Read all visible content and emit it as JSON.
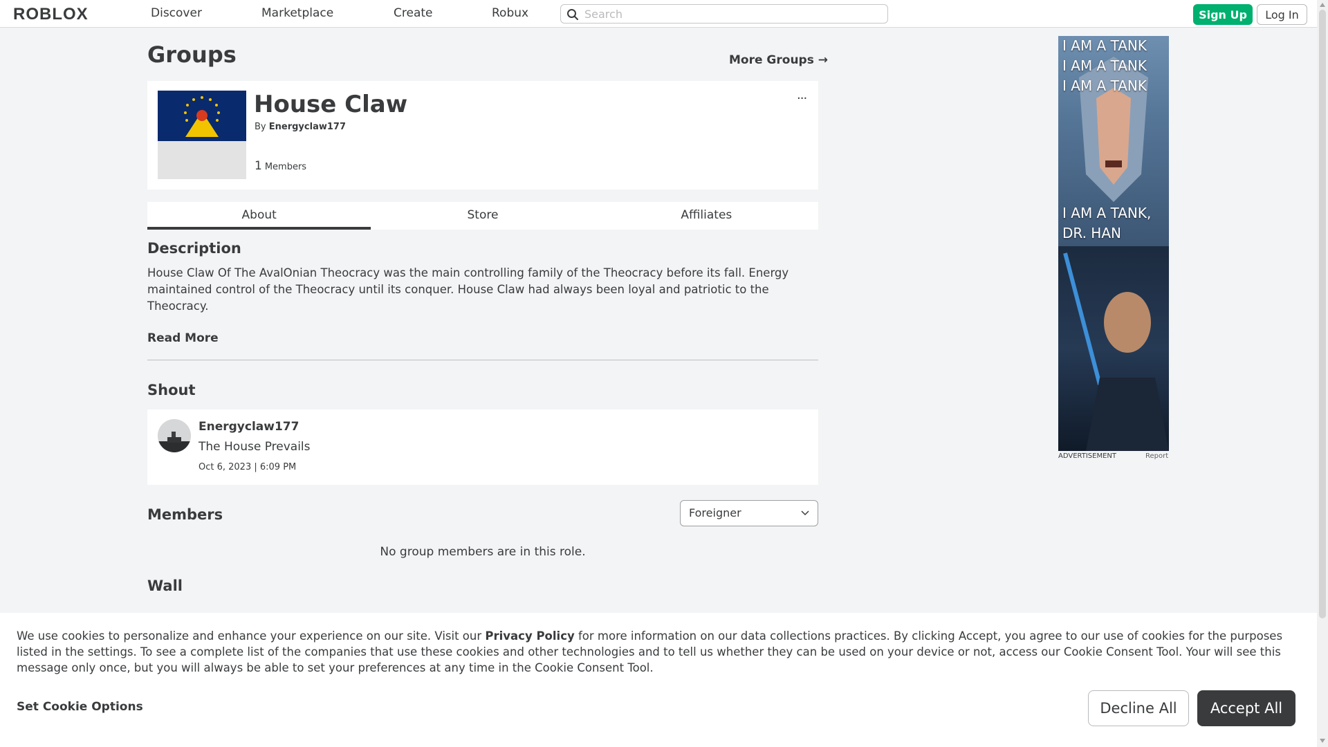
{
  "nav": {
    "logo": "ROBLOX",
    "links": [
      "Discover",
      "Marketplace",
      "Create",
      "Robux"
    ],
    "search_placeholder": "Search",
    "signup_label": "Sign Up",
    "login_label": "Log In"
  },
  "page": {
    "title": "Groups",
    "more_groups": "More Groups →"
  },
  "group": {
    "name": "House Claw",
    "by_prefix": "By",
    "owner": "Energyclaw177",
    "member_count": "1",
    "members_label": "Members",
    "more_icon": "..."
  },
  "tabs": [
    "About",
    "Store",
    "Affiliates"
  ],
  "about": {
    "description_heading": "Description",
    "description": "House Claw Of The AvalOnian Theocracy was the main controlling family of the Theocracy before its fall. Energy maintained control of the Theocracy until its conquer. House Claw had always been loyal and patriotic to the Theocracy.",
    "read_more": "Read More",
    "shout_heading": "Shout",
    "shout": {
      "user": "Energyclaw177",
      "text": "The House Prevails",
      "date": "Oct 6, 2023 | 6:09 PM"
    },
    "members_heading": "Members",
    "role_selected": "Foreigner",
    "no_members": "No group members are in this role.",
    "wall_heading": "Wall"
  },
  "ad": {
    "lines_top": [
      "I AM A TANK",
      "I AM A TANK",
      "I AM A TANK"
    ],
    "lines_mid": [
      "I AM A TANK,",
      "DR. HAN"
    ],
    "label": "ADVERTISEMENT",
    "report": "Report"
  },
  "cookie": {
    "text_before": "We use cookies to personalize and enhance your experience on our site. Visit our",
    "policy_link": "Privacy Policy",
    "text_after": "for more information on our data collections practices. By clicking Accept, you agree to our use of cookies for the purposes listed in the settings. To see a complete list of the companies that use these cookies and other technologies and to tell us whether they can be used on your device or not, access our Cookie Consent Tool. Your will see this message only once, but you will always be able to set your preferences at any time in the Cookie Consent Tool.",
    "options_label": "Set Cookie Options",
    "decline_label": "Decline All",
    "accept_label": "Accept All"
  },
  "colors": {
    "accent_green": "#00b06f",
    "text": "#393b3d",
    "background": "#f2f4f5",
    "flag_blue": "#0a2a6e",
    "flag_star": "#f2c400"
  }
}
